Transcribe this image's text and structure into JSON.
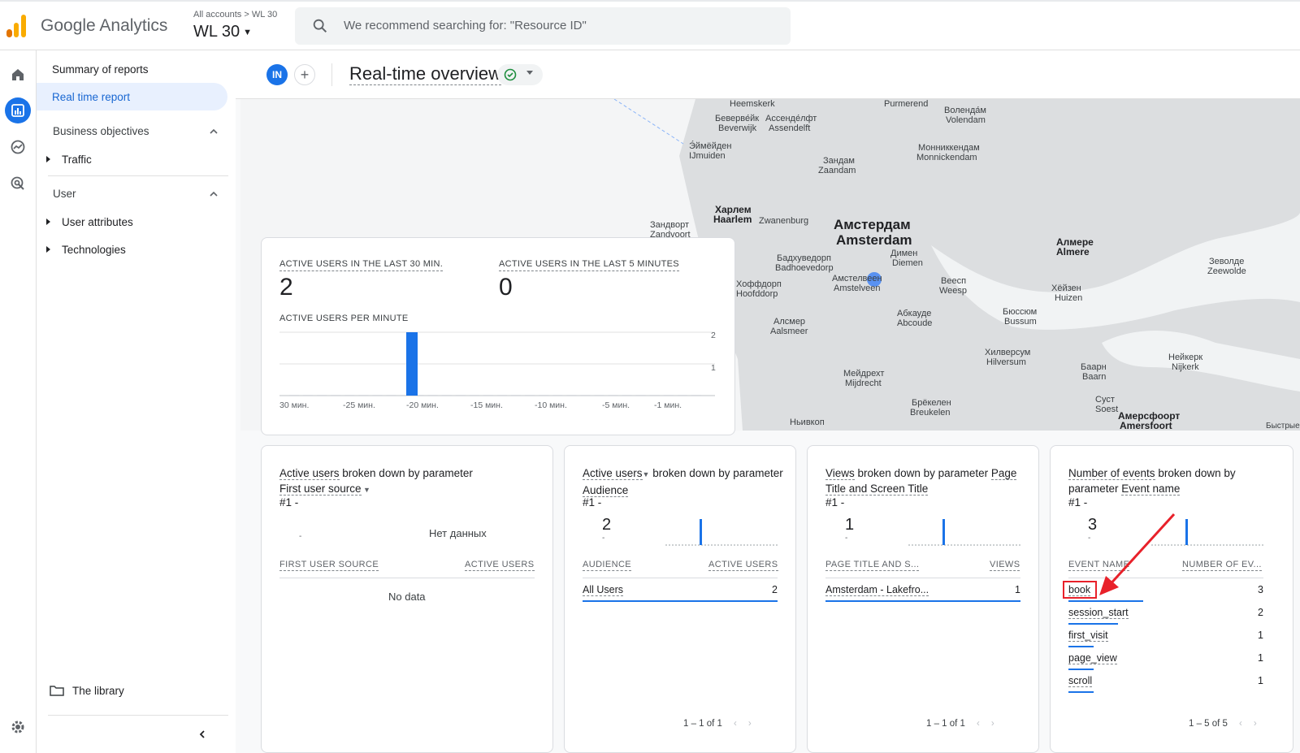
{
  "app": {
    "brand": "Google Analytics",
    "crumb_accounts": "All accounts",
    "crumb_sep": ">",
    "crumb_property": "WL 30",
    "property_name": "WL 30"
  },
  "search": {
    "placeholder": "We recommend searching for: \"Resource ID\""
  },
  "nav": {
    "summary": "Summary of reports",
    "realtime": "Real time report",
    "business_objectives": "Business objectives",
    "traffic": "Traffic",
    "user": "User",
    "user_attributes": "User attributes",
    "technologies": "Technologies",
    "library": "The library"
  },
  "header": {
    "avatar": "IN",
    "add": "+",
    "title": "Real-time overview"
  },
  "map_labels": [
    "Heemskerk",
    "Purmerend",
    "Воленда́м",
    "Volendam",
    "Беверве́йк",
    "Beverwijk",
    "Ассенде́лфт",
    "Assendelft",
    "Э́ймёйден",
    "IJmuiden",
    "Монниккендам",
    "Monnickendam",
    "Зандам",
    "Zaandam",
    "Харлем",
    "Haarlem",
    "Zwanenburg",
    "Зандворт",
    "Zandvoort",
    "Амстердам",
    "Amsterdam",
    "Алмере",
    "Almere",
    "Зеволде",
    "Zeewolde",
    "Бадхуведорп",
    "Badhoevedorp",
    "Димен",
    "Diemen",
    "Хоффдорп",
    "Hoofddorp",
    "Амстелвеен",
    "Amstelveen",
    "Веесп",
    "Weesp",
    "Хёйзен",
    "Huizen",
    "Алсмер",
    "Aalsmeer",
    "Абкауде",
    "Abcoude",
    "Бюссюм",
    "Bussum",
    "Хилверсум",
    "Hilversum",
    "Нейкерк",
    "Nijkerk",
    "Баарн",
    "Baarn",
    "Мейдрехт",
    "Mijdrecht",
    "Брёкелен",
    "Breukelen",
    "Суст",
    "Soest",
    "Амерсфоорт",
    "Amersfoort",
    "Ньивкоп",
    "Быстрые"
  ],
  "kpi": {
    "last30_label": "ACTIVE USERS IN THE LAST 30 MIN.",
    "last30_value": "2",
    "last5_label": "ACTIVE USERS IN THE LAST 5 MINUTES",
    "last5_value": "0",
    "per_minute_label": "ACTIVE USERS PER MINUTE",
    "y_ticks": [
      "2",
      "1"
    ],
    "x_ticks": [
      "30 мин.",
      "-25 мин.",
      "-20 мин.",
      "-15 мин.",
      "-10 мин.",
      "-5 мин.",
      "-1 мин."
    ],
    "per_minute_peak": {
      "minute": "-20 мин.",
      "value": 2
    }
  },
  "card1": {
    "title_a": "Active users",
    "title_b": " broken down by parameter",
    "param": "First user source",
    "rank": "#1  -",
    "no_data_top": "Нет данных",
    "dash": "-",
    "col1": "FIRST USER SOURCE",
    "col2": "ACTIVE USERS",
    "no_data": "No data"
  },
  "card2": {
    "title_a": "Active users",
    "title_b": " broken down by parameter ",
    "param": "Audience",
    "rank": "#1  -",
    "value": "2",
    "dash": "-",
    "col1": "AUDIENCE",
    "col2": "ACTIVE USERS",
    "rows": [
      {
        "k": "All Users",
        "v": "2"
      }
    ],
    "pager": "1 – 1 of 1"
  },
  "card3": {
    "title_a": "Views",
    "title_b": " broken down by parameter ",
    "param": "Page Title and Screen Title",
    "rank": "#1  -",
    "value": "1",
    "dash": "-",
    "col1": "PAGE TITLE AND S...",
    "col2": "VIEWS",
    "rows": [
      {
        "k": "Amsterdam - Lakefro...",
        "v": "1"
      }
    ],
    "pager": "1 – 1 of 1"
  },
  "card4": {
    "title_a": "Number of events",
    "title_b": " broken down by parameter ",
    "param": "Event name",
    "rank": "#1  -",
    "value": "3",
    "dash": "-",
    "col1": "EVENT NAME",
    "col2": "NUMBER OF EV...",
    "rows": [
      {
        "k": "book",
        "v": "3"
      },
      {
        "k": "session_start",
        "v": "2"
      },
      {
        "k": "first_visit",
        "v": "1"
      },
      {
        "k": "page_view",
        "v": "1"
      },
      {
        "k": "scroll",
        "v": "1"
      }
    ],
    "pager": "1 – 5 of 5"
  },
  "colors": {
    "accent": "#1a73e8",
    "annotation": "#e8212a",
    "check": "#1e8e3e"
  }
}
